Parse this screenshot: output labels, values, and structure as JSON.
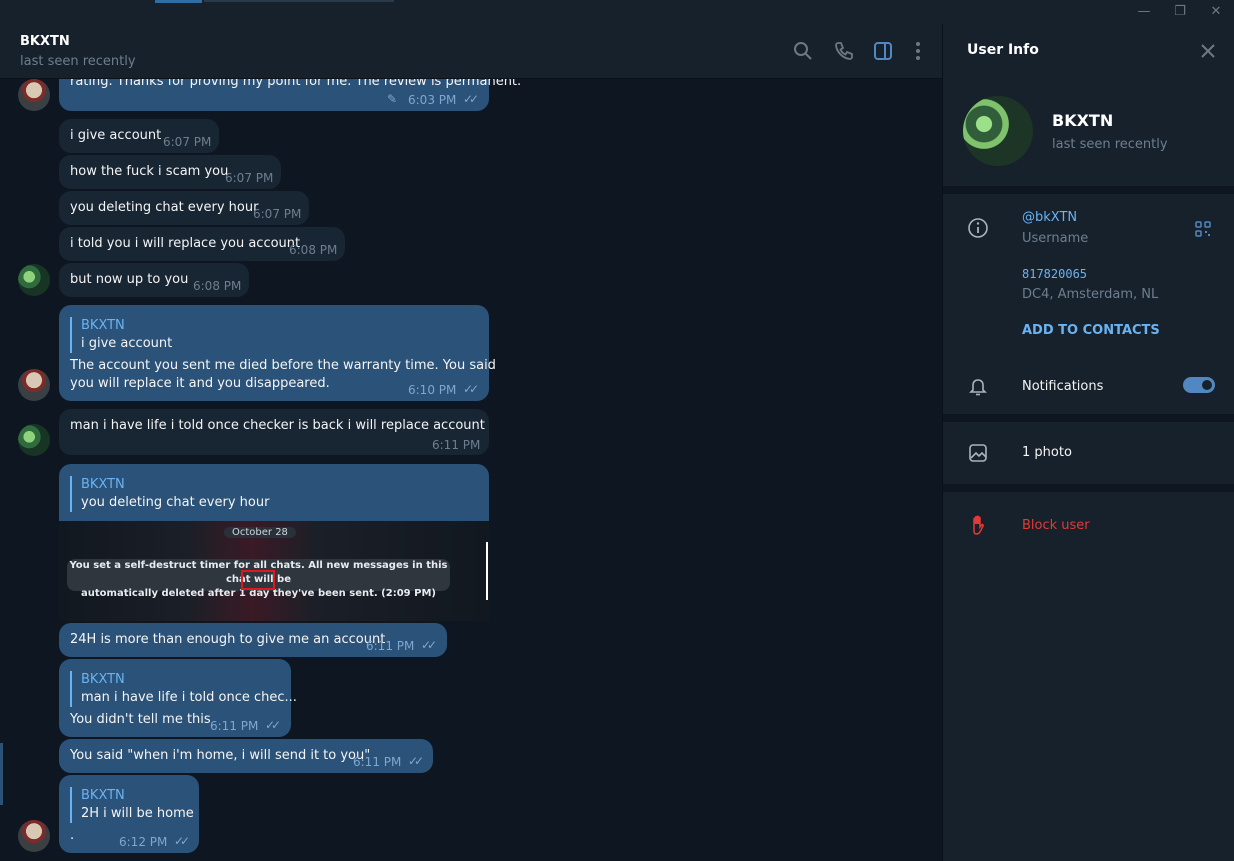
{
  "colors": {
    "accent": "#2b5278",
    "link": "#6ab3f3",
    "danger": "#e53935",
    "bg": "#0e1621",
    "panel": "#17212b"
  },
  "header": {
    "name": "BKXTN",
    "status": "last seen recently",
    "icons": [
      "search-icon",
      "phone-icon",
      "sidebar-toggle-icon",
      "more-vert-icon"
    ]
  },
  "messages": {
    "m0": {
      "text": "rating. Thanks for proving my point for me. The review is permanent.",
      "time": "6:03 PM"
    },
    "m1": {
      "text": "i give account",
      "time": "6:07 PM"
    },
    "m2": {
      "text": "how the fuck i scam you",
      "time": "6:07 PM"
    },
    "m3": {
      "text": "you deleting chat every hour",
      "time": "6:07 PM"
    },
    "m4": {
      "text": "i told you i will replace you account",
      "time": "6:08 PM"
    },
    "m5": {
      "text": "but now up to you",
      "time": "6:08 PM"
    },
    "m6": {
      "reply_name": "BKXTN",
      "reply_text": "i give account",
      "line1": "The account you sent me died before the warranty time. You said",
      "line2": "you will replace it and you disappeared.",
      "time": "6:10 PM"
    },
    "m7": {
      "text": "man i have life  i told once checker is back i will replace account",
      "time": "6:11 PM"
    },
    "m8": {
      "reply_name": "BKXTN",
      "reply_text": "you deleting chat every hour",
      "screenshot": {
        "date": "October 28",
        "line1": "You set a self-destruct timer for all chats. All new messages in this chat will be",
        "line2": "automatically deleted after 1 day they've been sent. (2:09 PM)"
      }
    },
    "m9": {
      "text": "24H is more than enough to give me an account",
      "time": "6:11 PM"
    },
    "m10": {
      "reply_name": "BKXTN",
      "reply_text": "man i have life  i told once chec...",
      "text": "You didn't tell me this",
      "time": "6:11 PM"
    },
    "m11": {
      "text": "You said \"when i'm home, i will send it to you\"",
      "time": "6:11 PM"
    },
    "m12": {
      "reply_name": "BKXTN",
      "reply_text": "2H i will be home",
      "text": ".",
      "time": "6:12 PM"
    }
  },
  "info": {
    "title": "User Info",
    "name": "BKXTN",
    "status": "last seen recently",
    "username": "@bkXTN",
    "username_label": "Username",
    "phone": "817820065",
    "dc": "DC4, Amsterdam, NL",
    "add_contacts": "ADD TO CONTACTS",
    "notifications": "Notifications",
    "notifications_on": true,
    "photos": "1 photo",
    "block": "Block user"
  }
}
